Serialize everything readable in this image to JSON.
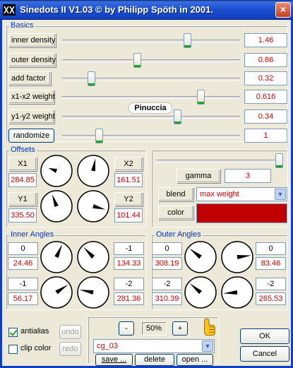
{
  "window": {
    "title": "Sinedots II V1.03 © by Philipp Spöth in 2001.",
    "close": "×"
  },
  "basics": {
    "label": "Basics",
    "rows": [
      {
        "label": "inner density",
        "value": "1.46"
      },
      {
        "label": "outer density",
        "value": "0.86"
      },
      {
        "label": "add factor",
        "value": "0.32"
      },
      {
        "label": "x1-x2 weight",
        "value": "0.616"
      },
      {
        "label": "y1-y2 weight",
        "value": "0.34"
      }
    ],
    "randomize": {
      "label": "randomize",
      "value": "1"
    }
  },
  "watermark": "Pinuccia",
  "offsets": {
    "label": "Offsets",
    "x1": {
      "label": "X1",
      "value": "284.85"
    },
    "x2": {
      "label": "X2",
      "value": "161.51"
    },
    "y1": {
      "label": "Y1",
      "value": "335.50"
    },
    "y2": {
      "label": "Y2",
      "value": "101.44"
    }
  },
  "gamma": {
    "label": "gamma",
    "value": "3"
  },
  "blend": {
    "label": "blend",
    "selected": "max weight"
  },
  "color": {
    "label": "color",
    "swatch": "#c00000"
  },
  "inner_angles": {
    "label": "Inner Angles",
    "top_left": {
      "mult": "0",
      "value": "24.46"
    },
    "top_right": {
      "mult": "-1",
      "value": "134.33"
    },
    "bottom_left": {
      "mult": "-1",
      "value": "56.17"
    },
    "bottom_right": {
      "mult": "-2",
      "value": "281.36"
    }
  },
  "outer_angles": {
    "label": "Outer Angles",
    "top_left": {
      "mult": "0",
      "value": "308.19"
    },
    "top_right": {
      "mult": "0",
      "value": "83.46"
    },
    "bottom_left": {
      "mult": "-2",
      "value": "310.39"
    },
    "bottom_right": {
      "mult": "-2",
      "value": "265.53"
    }
  },
  "bottom": {
    "antialias": "antialias",
    "clip_color": "clip color",
    "undo": "undo",
    "redo": "redo",
    "zoom_minus": "-",
    "zoom": "50%",
    "zoom_plus": "+",
    "preset": "cg_03",
    "save": "save ...",
    "delete": "delete",
    "open": "open ...",
    "ok": "OK",
    "cancel": "Cancel"
  },
  "colors": {
    "accent_red": "#cc0000",
    "title_blue": "#1b4fd0",
    "group_label": "#0033cc"
  }
}
